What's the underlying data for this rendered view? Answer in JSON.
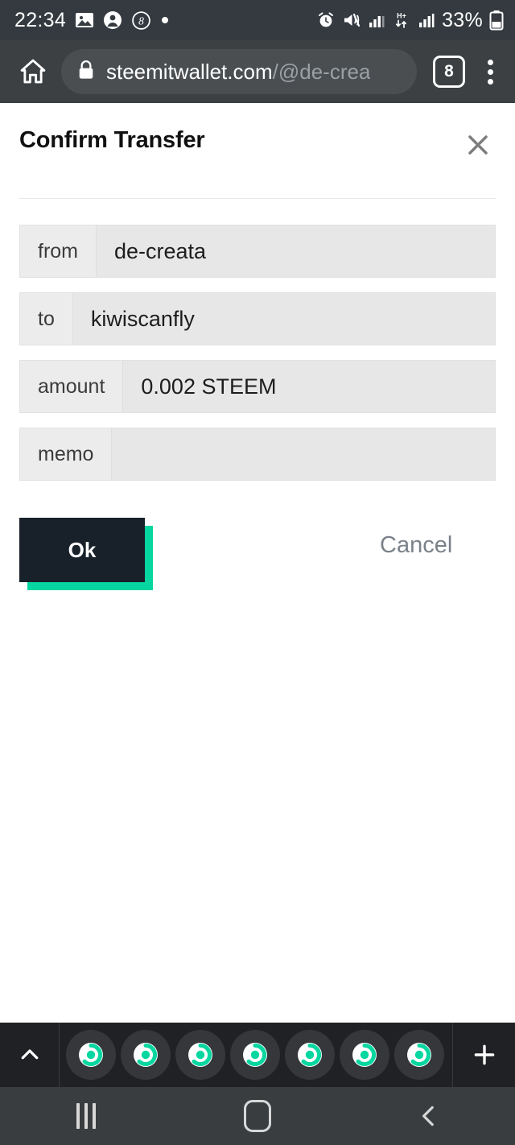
{
  "status_bar": {
    "time": "22:34",
    "battery_percent": "33%",
    "left_icons": [
      "image-icon",
      "contact-icon",
      "circled-8-icon",
      "dot-icon"
    ],
    "right_icons": [
      "alarm-icon",
      "vibrate-mute-icon",
      "signal-bars-icon",
      "hplus-data-icon",
      "signal-bars-2-icon",
      "battery-icon"
    ]
  },
  "browser": {
    "home_icon": "home-icon",
    "lock_icon": "lock-icon",
    "url_host": "steemitwallet.com",
    "url_path": "/@de-crea",
    "tab_count": "8",
    "menu_icon": "kebab-menu-icon"
  },
  "dialog": {
    "title": "Confirm Transfer",
    "close_icon": "close-icon",
    "fields": [
      {
        "label": "from",
        "value": "de-creata"
      },
      {
        "label": "to",
        "value": "kiwiscanfly"
      },
      {
        "label": "amount",
        "value": "0.002 STEEM"
      },
      {
        "label": "memo",
        "value": ""
      }
    ],
    "ok_label": "Ok",
    "cancel_label": "Cancel"
  },
  "tab_strip": {
    "expand_icon": "chevron-up-icon",
    "add_icon": "plus-icon",
    "favicon_name": "steemit-logo-icon",
    "open_tabs": 7
  },
  "nav_bar": {
    "recents_icon": "recents-icon",
    "home_icon": "home-square-icon",
    "back_icon": "back-chevron-icon"
  },
  "colors": {
    "accent_teal": "#06d6a0",
    "button_dark": "#18202a",
    "chrome_bg": "#3c4043",
    "status_bg": "#343a40",
    "field_bg": "#e7e7e7"
  }
}
